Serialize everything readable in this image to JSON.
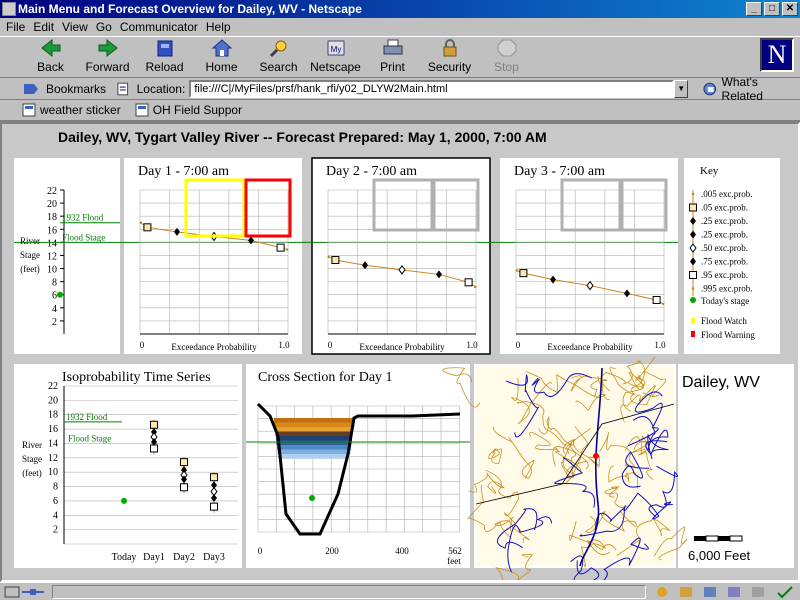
{
  "window": {
    "title": "Main Menu and Forecast Overview for Dailey, WV - Netscape",
    "min_label": "_",
    "max_label": "□",
    "close_label": "✕"
  },
  "menu": [
    "File",
    "Edit",
    "View",
    "Go",
    "Communicator",
    "Help"
  ],
  "toolbar": [
    {
      "label": "Back",
      "icon": "back-arrow-icon"
    },
    {
      "label": "Forward",
      "icon": "forward-arrow-icon"
    },
    {
      "label": "Reload",
      "icon": "reload-icon"
    },
    {
      "label": "Home",
      "icon": "home-icon"
    },
    {
      "label": "Search",
      "icon": "search-icon"
    },
    {
      "label": "Netscape",
      "icon": "netscape-icon"
    },
    {
      "label": "Print",
      "icon": "print-icon"
    },
    {
      "label": "Security",
      "icon": "lock-icon"
    },
    {
      "label": "Stop",
      "icon": "stop-icon",
      "disabled": true
    }
  ],
  "location": {
    "bookmarks_label": "Bookmarks",
    "location_label": "Location:",
    "url": "file:///C|/MyFiles/prsf/hank_rfi/y02_DLYW2Main.html",
    "related_label": "What's Related"
  },
  "personal": {
    "items": [
      "weather sticker",
      "OH Field Suppor"
    ]
  },
  "page": {
    "title": "Dailey, WV, Tygart Valley River -- Forecast Prepared: May 1, 2000, 7:00 AM"
  },
  "colors": {
    "flood_watch": "#ffff00",
    "flood_warning": "#ff0000",
    "todays_stage": "#00aa00",
    "flood_line": "#008000"
  },
  "stage_axis": {
    "ticks": [
      "2",
      "4",
      "6",
      "8",
      "10",
      "12",
      "14",
      "16",
      "18",
      "20",
      "22"
    ],
    "ylabel_lines": [
      "River",
      "Stage",
      "(feet)"
    ],
    "flood_1932_label": "1932 Flood",
    "flood_stage_label": "Flood Stage"
  },
  "chart_data": [
    {
      "type": "line",
      "title": "Day 1 - 7:00 am",
      "xlabel": "Exceedance Probability",
      "x_ticks": [
        "0",
        "1.0"
      ],
      "ylim": [
        0,
        22
      ],
      "x": [
        0.005,
        0.05,
        0.25,
        0.5,
        0.75,
        0.95,
        0.995
      ],
      "values": [
        17.0,
        16.3,
        15.6,
        14.9,
        14.3,
        13.2,
        12.9
      ],
      "flood_1932": 17.0,
      "flood_stage": 14.0
    },
    {
      "type": "line",
      "title": "Day 2 - 7:00 am",
      "xlabel": "Exceedance Probability",
      "x_ticks": [
        "0",
        "1.0"
      ],
      "ylim": [
        0,
        22
      ],
      "x": [
        0.005,
        0.05,
        0.25,
        0.5,
        0.75,
        0.95,
        0.995
      ],
      "values": [
        11.8,
        11.3,
        10.5,
        9.8,
        9.1,
        7.9,
        7.2
      ],
      "flood_stage": 14.0
    },
    {
      "type": "line",
      "title": "Day 3 - 7:00 am",
      "xlabel": "Exceedance Probability",
      "x_ticks": [
        "0",
        "1.0"
      ],
      "ylim": [
        0,
        22
      ],
      "x": [
        0.005,
        0.05,
        0.25,
        0.5,
        0.75,
        0.95,
        0.995
      ],
      "values": [
        9.7,
        9.3,
        8.3,
        7.4,
        6.2,
        5.2,
        4.6
      ],
      "flood_stage": 14.0
    },
    {
      "type": "scatter",
      "title": "Isoprobability Time Series",
      "categories": [
        "Today",
        "Day1",
        "Day2",
        "Day3"
      ],
      "ylim": [
        0,
        22
      ],
      "todays_stage": 6.0,
      "series": [
        {
          "name": ".05 exc.prob.",
          "values": [
            null,
            16.6,
            11.4,
            9.3
          ]
        },
        {
          "name": ".25 exc.prob.",
          "values": [
            null,
            15.6,
            10.3,
            8.2
          ]
        },
        {
          "name": ".50 exc.prob.",
          "values": [
            null,
            14.9,
            9.6,
            7.3
          ]
        },
        {
          "name": ".75 exc.prob.",
          "values": [
            null,
            14.2,
            9.0,
            6.4
          ]
        },
        {
          "name": ".95 exc.prob.",
          "values": [
            null,
            13.3,
            7.9,
            5.2
          ]
        }
      ]
    },
    {
      "type": "area",
      "title": "Cross Section for Day 1",
      "x_ticks": [
        "0",
        "200",
        "400",
        "562"
      ],
      "x_unit": "feet"
    }
  ],
  "key": {
    "title": "Key",
    "items": [
      {
        "label": ".005 exc.prob.",
        "marker": "dot"
      },
      {
        "label": ".05 exc.prob.",
        "marker": "square-fill"
      },
      {
        "label": ".25 exc.prob.",
        "marker": "diamond-black"
      },
      {
        "label": ".25 exc.prob.",
        "marker": "diamond-black"
      },
      {
        "label": ".50 exc.prob.",
        "marker": "diamond-white"
      },
      {
        "label": ".75 exc.prob.",
        "marker": "diamond-black"
      },
      {
        "label": ".95 exc.prob.",
        "marker": "square-white"
      },
      {
        "label": ".995 exc.prob.",
        "marker": "dot"
      }
    ],
    "todays_stage": "Today's stage",
    "flood_watch": "Flood Watch",
    "flood_warning": "Flood Warning"
  },
  "map": {
    "title": "Dailey, WV",
    "scale_label": "6,000 Feet"
  }
}
